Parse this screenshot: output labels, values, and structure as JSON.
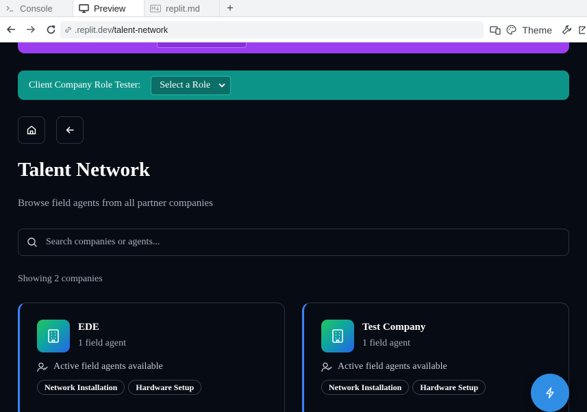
{
  "browser": {
    "tabs": [
      {
        "label": "Console",
        "icon": "terminal-icon",
        "active": false
      },
      {
        "label": "Preview",
        "icon": "monitor-icon",
        "active": true
      },
      {
        "label": "replit.md",
        "icon": "markdown-icon",
        "active": false
      }
    ],
    "new_tab_label": "+",
    "url_host": ".replit.dev",
    "url_path": "/talent-network",
    "theme_label": "Theme"
  },
  "page": {
    "role_tester": {
      "label": "Client Company Role Tester:",
      "select_value": "Select a Role"
    },
    "title": "Talent Network",
    "subtitle": "Browse field agents from all partner companies",
    "search": {
      "placeholder": "Search companies or agents..."
    },
    "showing_text": "Showing 2 companies",
    "companies": [
      {
        "name": "EDE",
        "agent_count": "1 field agent",
        "availability": "Active field agents available",
        "tags": [
          "Network Installation",
          "Hardware Setup"
        ]
      },
      {
        "name": "Test Company",
        "agent_count": "1 field agent",
        "availability": "Active field agents available",
        "tags": [
          "Network Installation",
          "Hardware Setup"
        ]
      }
    ]
  },
  "colors": {
    "background": "#070b14",
    "purple_banner": "#9b3ef0",
    "teal_bar": "#0d9488",
    "card_accent": "#3b82f6",
    "fab": "#2f8de4"
  }
}
